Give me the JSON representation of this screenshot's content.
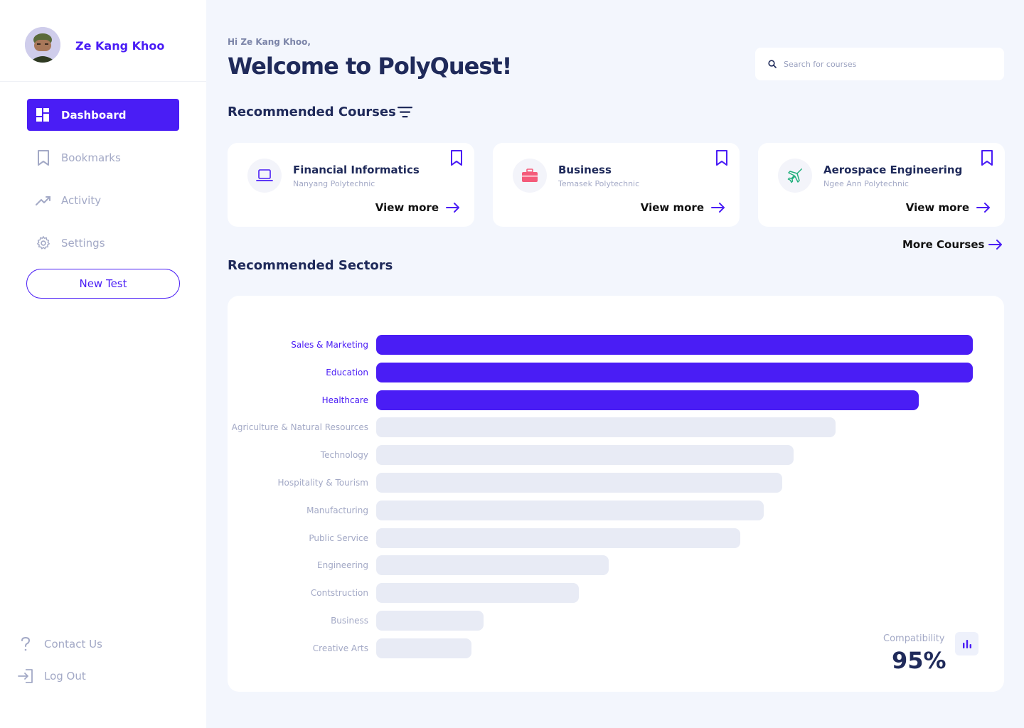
{
  "user": {
    "name": "Ze Kang Khoo"
  },
  "sidebar": {
    "nav": [
      {
        "label": "Dashboard",
        "icon": "dashboard-icon",
        "active": true
      },
      {
        "label": "Bookmarks",
        "icon": "bookmark-icon"
      },
      {
        "label": "Activity",
        "icon": "activity-icon"
      },
      {
        "label": "Settings",
        "icon": "gear-icon"
      }
    ],
    "new_test_label": "New Test",
    "contact_label": "Contact Us",
    "logout_label": "Log Out"
  },
  "header": {
    "greeting": "Hi Ze Kang Khoo,",
    "title": "Welcome to PolyQuest!",
    "search_placeholder": "Search for courses"
  },
  "courses": {
    "title": "Recommended Courses",
    "items": [
      {
        "name": "Financial Informatics",
        "school": "Nanyang Polytechnic",
        "icon": "laptop-icon",
        "action": "View more"
      },
      {
        "name": "Business",
        "school": "Temasek Polytechnic",
        "icon": "briefcase-icon",
        "action": "View more"
      },
      {
        "name": "Aerospace Engineering",
        "school": "Ngee Ann Polytechnic",
        "icon": "airplane-icon",
        "action": "View more"
      }
    ],
    "more_label": "More Courses"
  },
  "sectors": {
    "title": "Recommended Sectors",
    "compatibility_label": "Compatibility",
    "compatibility_value": "95%"
  },
  "colors": {
    "accent": "#4a1df5",
    "muted_bar": "#e8ebf5",
    "text_dark": "#1f2a5a",
    "text_muted": "#a3a9c6"
  },
  "chart_data": {
    "type": "bar",
    "orientation": "horizontal",
    "categories": [
      "Sales & Marketing",
      "Education",
      "Healthcare",
      "Agriculture & Natural Resources",
      "Technology",
      "Hospitality & Tourism",
      "Manufacturing",
      "Public Service",
      "Engineering",
      "Contstruction",
      "Business",
      "Creative Arts"
    ],
    "values": [
      100,
      100,
      91,
      77,
      70,
      68,
      65,
      61,
      39,
      34,
      18,
      16
    ],
    "highlighted": [
      true,
      true,
      true,
      false,
      false,
      false,
      false,
      false,
      false,
      false,
      false,
      false
    ],
    "xlim": [
      0,
      100
    ]
  }
}
